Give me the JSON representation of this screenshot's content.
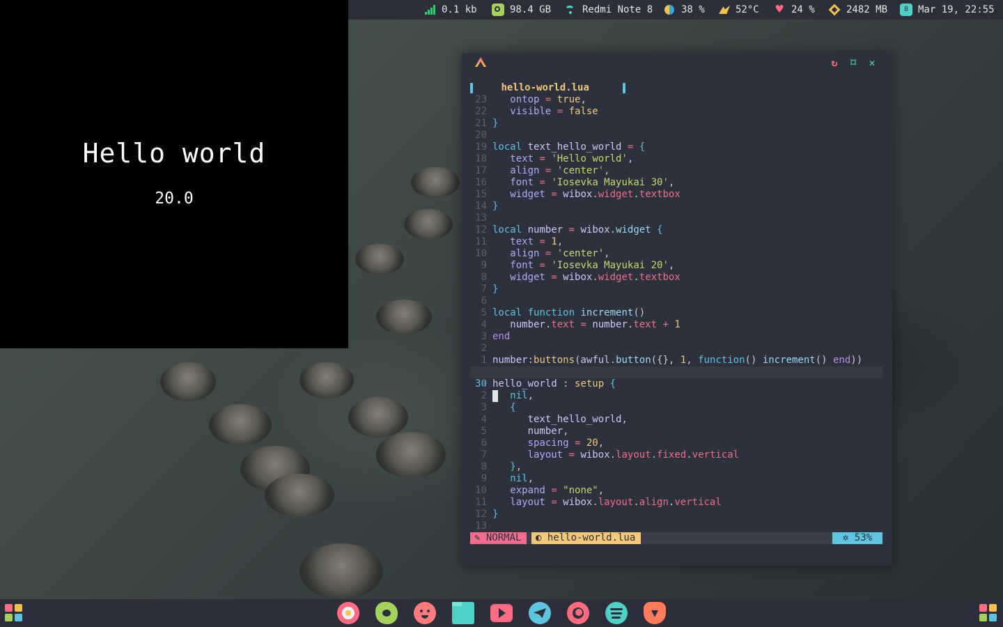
{
  "topbar": {
    "net": "0.1 kb",
    "disk": "98.4 GB",
    "wifi": "Redmi Note 8",
    "volume": "38 %",
    "temp": "52°C",
    "battery": "24 %",
    "memory": "2482 MB",
    "calendar_badge": "8",
    "datetime": "Mar 19, 22:55",
    "icons": [
      "signal-icon",
      "disk-icon",
      "wifi-icon",
      "volume-icon",
      "temperature-icon",
      "heart-icon",
      "memory-icon",
      "calendar-icon"
    ]
  },
  "widget": {
    "title": "Hello world",
    "number": "20.0"
  },
  "editor": {
    "tab_file": "hello-world.lua",
    "mode": "NORMAL",
    "status_file": "hello-world.lua",
    "percent": "53%",
    "current_line_number": "30",
    "lines_before": [
      {
        "n": "23",
        "text": "   ontop = true,"
      },
      {
        "n": "22",
        "text": "   visible = false"
      },
      {
        "n": "21",
        "text": "}"
      },
      {
        "n": "20",
        "text": ""
      },
      {
        "n": "19",
        "text": "local text_hello_world = {"
      },
      {
        "n": "18",
        "text": "   text = 'Hello world',"
      },
      {
        "n": "17",
        "text": "   align = 'center',"
      },
      {
        "n": "16",
        "text": "   font = 'Iosevka Mayukai 30',"
      },
      {
        "n": "15",
        "text": "   widget = wibox.widget.textbox"
      },
      {
        "n": "14",
        "text": "}"
      },
      {
        "n": "13",
        "text": ""
      },
      {
        "n": "12",
        "text": "local number = wibox.widget {"
      },
      {
        "n": "11",
        "text": "   text = 1,"
      },
      {
        "n": "10",
        "text": "   align = 'center',"
      },
      {
        "n": "9",
        "text": "   font = 'Iosevka Mayukai 20',"
      },
      {
        "n": "8",
        "text": "   widget = wibox.widget.textbox"
      },
      {
        "n": "7",
        "text": "}"
      },
      {
        "n": "6",
        "text": ""
      },
      {
        "n": "5",
        "text": "local function increment()"
      },
      {
        "n": "4",
        "text": "   number.text = number.text + 1"
      },
      {
        "n": "3",
        "text": "end"
      },
      {
        "n": "2",
        "text": ""
      },
      {
        "n": "1",
        "text": "number:buttons(awful.button({}, 1, function() increment() end))"
      }
    ],
    "lines_after": [
      {
        "n": "1",
        "text": "hello_world : setup {"
      },
      {
        "n": "2",
        "text": "   nil,"
      },
      {
        "n": "3",
        "text": "   {"
      },
      {
        "n": "4",
        "text": "      text_hello_world,"
      },
      {
        "n": "5",
        "text": "      number,"
      },
      {
        "n": "6",
        "text": "      spacing = 20,"
      },
      {
        "n": "7",
        "text": "      layout = wibox.layout.fixed.vertical"
      },
      {
        "n": "8",
        "text": "   },"
      },
      {
        "n": "9",
        "text": "   nil,"
      },
      {
        "n": "10",
        "text": "   expand = \"none\","
      },
      {
        "n": "11",
        "text": "   layout = wibox.layout.align.vertical"
      },
      {
        "n": "12",
        "text": "}"
      },
      {
        "n": "13",
        "text": ""
      }
    ]
  },
  "window_controls": [
    "refresh-icon",
    "maximize-icon",
    "close-icon"
  ],
  "dock": {
    "apps": [
      {
        "name": "music-player-icon",
        "color": "#ff6b81"
      },
      {
        "name": "cloud-app-icon",
        "color": "#a4d35b"
      },
      {
        "name": "face-app-icon",
        "color": "#ff7b7b"
      },
      {
        "name": "files-icon",
        "color": "#4fd1c5"
      },
      {
        "name": "youtube-icon",
        "color": "#ff6b81"
      },
      {
        "name": "telegram-icon",
        "color": "#5ec4e0"
      },
      {
        "name": "firefox-icon",
        "color": "#ff6b81"
      },
      {
        "name": "spotify-icon",
        "color": "#4fd1c5"
      },
      {
        "name": "brave-icon",
        "color": "#ff7b5b"
      }
    ]
  }
}
